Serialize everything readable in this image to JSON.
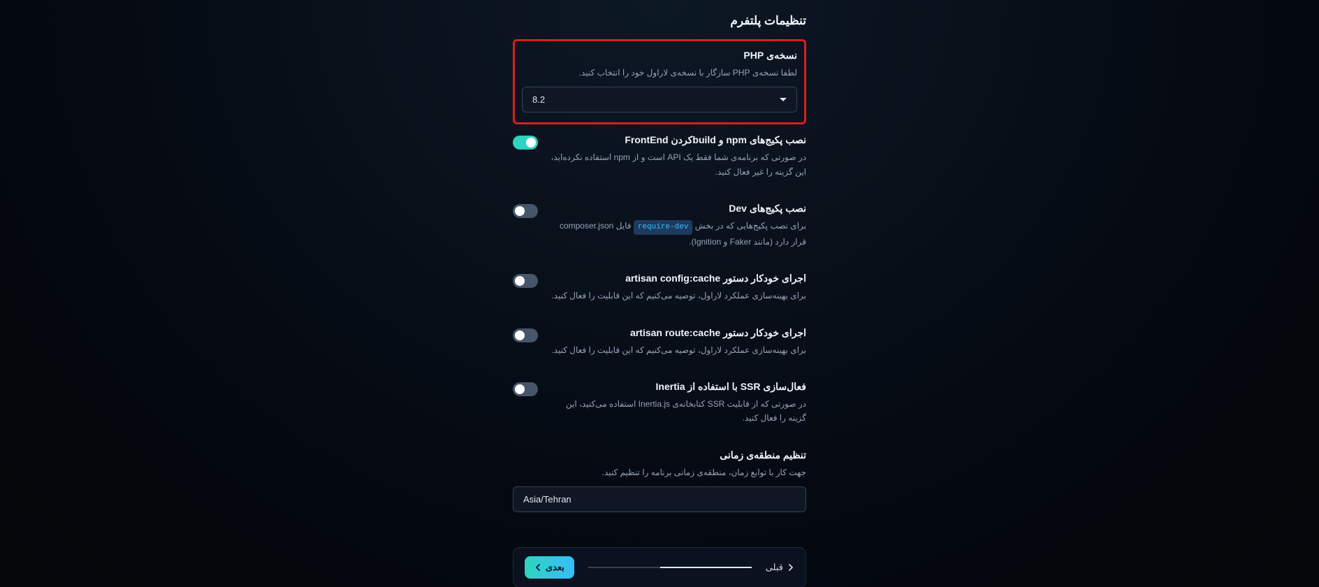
{
  "page_title": "تنظیمات پلتفرم",
  "php": {
    "title": "نسخه‌ی PHP",
    "desc": "لطفا نسخه‌ی PHP سازگار با نسخه‌ی لاراول خود را انتخاب کنید.",
    "value": "8.2"
  },
  "npm": {
    "title": "نصب پکیج‌های npm و buildکردن FrontEnd",
    "desc": "در صورتی که برنامه‌ی شما فقط یک API است و از npm استفاده نکرده‌اید، این گزینه را غیر فعال کنید.",
    "on": true
  },
  "dev": {
    "title": "نصب پکیج‌های Dev",
    "desc_before": "برای نصب پکیج‌هایی که در بخش ",
    "desc_code": "require-dev",
    "desc_after": " فایل composer.json قرار دارد (مانند Faker و Ignition).",
    "on": false
  },
  "config_cache": {
    "title": "اجرای خودکار دستور artisan config:cache",
    "desc": "برای بهینه‌سازی عملکرد لاراول، توصیه می‌کنیم که این قابلیت را فعال کنید.",
    "on": false
  },
  "route_cache": {
    "title": "اجرای خودکار دستور artisan route:cache",
    "desc": "برای بهینه‌سازی عملکرد لاراول، توصیه می‌کنیم که این قابلیت را فعال کنید.",
    "on": false
  },
  "ssr": {
    "title": "فعال‌سازی SSR با استفاده از Inertia",
    "desc": "در صورتی که از قابلیت SSR کتابخانه‌ی Inertia.js استفاده می‌کنید، این گزینه را فعال کنید.",
    "on": false
  },
  "timezone": {
    "title": "تنظیم منطقه‌ی زمانی",
    "desc": "جهت کار با توابع زمان، منطقه‌ی زمانی برنامه را تنظیم کنید.",
    "value": "Asia/Tehran"
  },
  "nav": {
    "prev": "قبلی",
    "next": "بعدی"
  }
}
